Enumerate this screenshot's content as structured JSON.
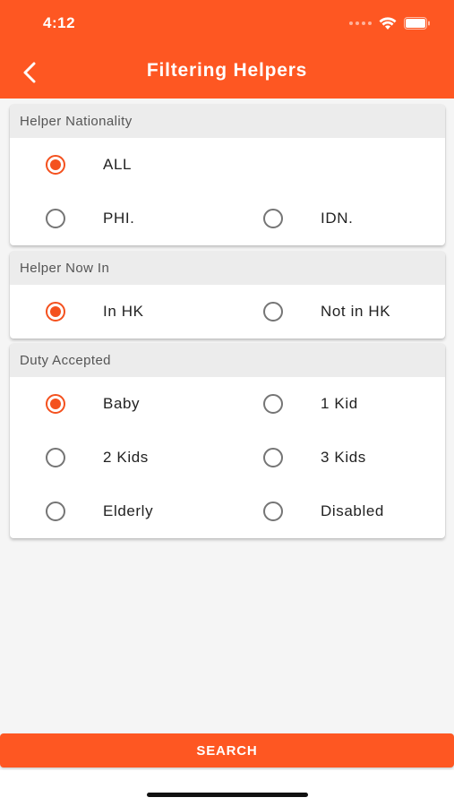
{
  "status_bar": {
    "time": "4:12"
  },
  "header": {
    "title": "Filtering Helpers",
    "back_icon": "chevron-left-icon"
  },
  "sections": {
    "nationality": {
      "title": "Helper Nationality",
      "options": [
        {
          "label": "ALL",
          "selected": true
        },
        {
          "label": "PHI.",
          "selected": false
        },
        {
          "label": "IDN.",
          "selected": false
        }
      ]
    },
    "location": {
      "title": "Helper Now In",
      "options": [
        {
          "label": "In HK",
          "selected": true
        },
        {
          "label": "Not in HK",
          "selected": false
        }
      ]
    },
    "duty": {
      "title": "Duty Accepted",
      "options": [
        {
          "label": "Baby",
          "selected": true
        },
        {
          "label": "1 Kid",
          "selected": false
        },
        {
          "label": "2 Kids",
          "selected": false
        },
        {
          "label": "3 Kids",
          "selected": false
        },
        {
          "label": "Elderly",
          "selected": false
        },
        {
          "label": "Disabled",
          "selected": false
        }
      ]
    }
  },
  "actions": {
    "search_label": "SEARCH"
  },
  "colors": {
    "accent": "#fe5722",
    "radio_selected": "#f4511e",
    "section_header_bg": "#ececec"
  }
}
